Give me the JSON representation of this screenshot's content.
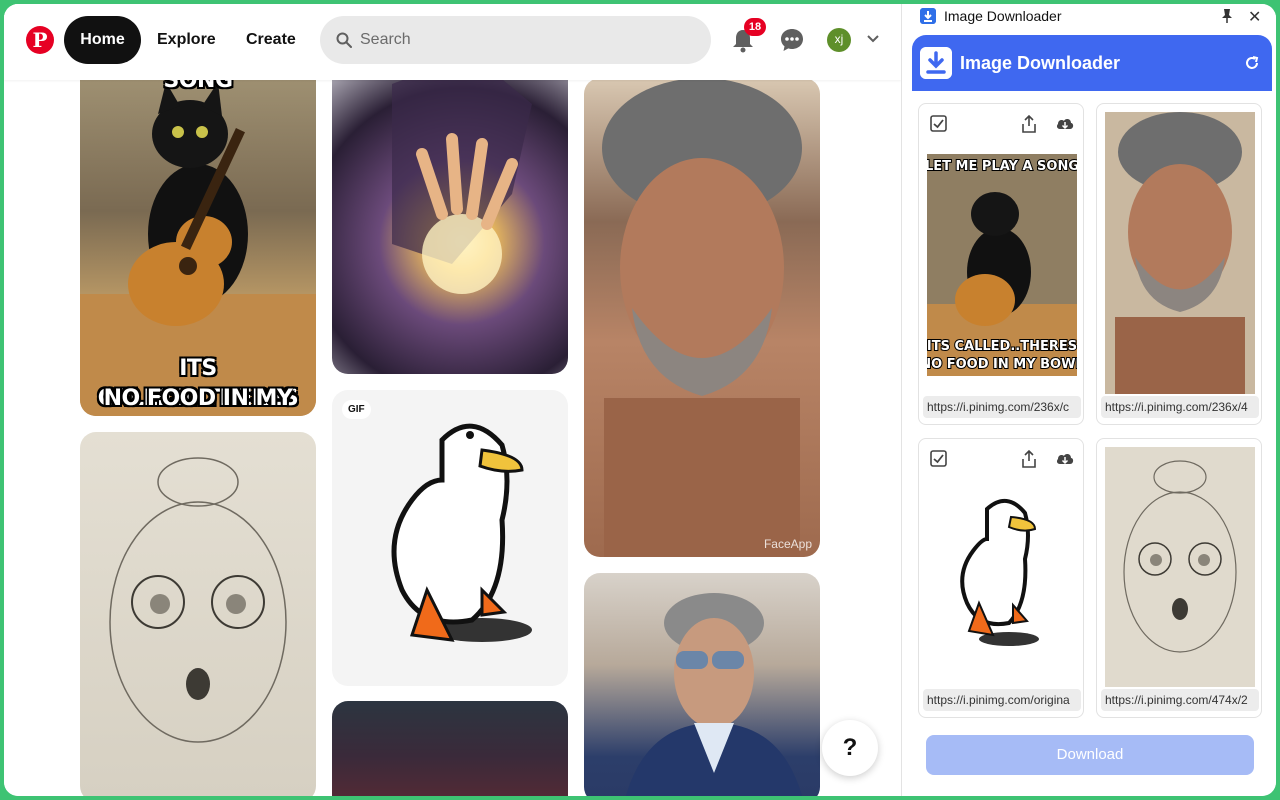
{
  "nav": {
    "logo": "P",
    "home": "Home",
    "explore": "Explore",
    "create": "Create",
    "search_placeholder": "Search",
    "notification_count": "18",
    "avatar_initials": "xj"
  },
  "pins": {
    "cat_top": "LET ME PLAY A SONG",
    "cat_bottom_1": "ITS CALLED..THERES",
    "cat_bottom_2": "NO FOOD IN MY BOWL",
    "gif_badge": "GIF",
    "faceapp": "FaceApp"
  },
  "help": "?",
  "extension": {
    "window_title": "Image Downloader",
    "header_title": "Image Downloader",
    "cards": [
      {
        "url": "https://i.pinimg.com/236x/c"
      },
      {
        "url": "https://i.pinimg.com/236x/4"
      },
      {
        "url": "https://i.pinimg.com/origina"
      },
      {
        "url": "https://i.pinimg.com/474x/2"
      }
    ],
    "download_label": "Download"
  },
  "colors": {
    "frame_border": "#3ec373",
    "pinterest_red": "#e60023",
    "extension_blue": "#3f68f0",
    "download_button": "#a6bbf6"
  }
}
